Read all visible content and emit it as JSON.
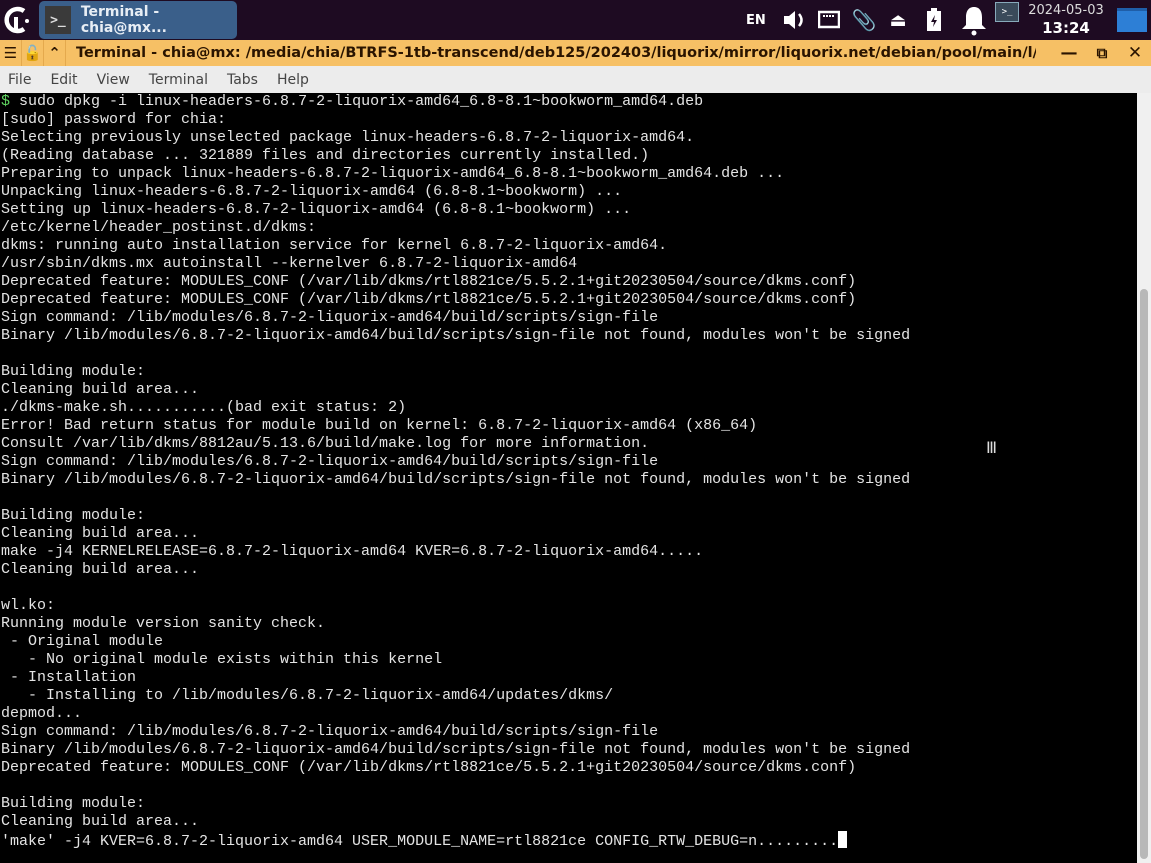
{
  "panel": {
    "task_title": "Terminal - chia@mx...",
    "lang": "EN",
    "date": "2024-05-03",
    "time": "13:24",
    "tray_icons": [
      "volume-icon",
      "network-icon",
      "clipboard-icon",
      "eject-icon",
      "battery-icon",
      "notification-bell-icon",
      "terminal-icon"
    ]
  },
  "window": {
    "title": "Terminal - chia@mx: /media/chia/BTRFS-1tb-transcend/deb125/202403/liquorix/mirror/liquorix.net/debian/pool/main/l/linux-liquorix",
    "accent": "#f6c065"
  },
  "menu": [
    "File",
    "Edit",
    "View",
    "Terminal",
    "Tabs",
    "Help"
  ],
  "terminal": {
    "prompt": "$",
    "command": " sudo dpkg -i linux-headers-6.8.7-2-liquorix-amd64_6.8-8.1~bookworm_amd64.deb",
    "lines": [
      "[sudo] password for chia:",
      "Selecting previously unselected package linux-headers-6.8.7-2-liquorix-amd64.",
      "(Reading database ... 321889 files and directories currently installed.)",
      "Preparing to unpack linux-headers-6.8.7-2-liquorix-amd64_6.8-8.1~bookworm_amd64.deb ...",
      "Unpacking linux-headers-6.8.7-2-liquorix-amd64 (6.8-8.1~bookworm) ...",
      "Setting up linux-headers-6.8.7-2-liquorix-amd64 (6.8-8.1~bookworm) ...",
      "/etc/kernel/header_postinst.d/dkms:",
      "dkms: running auto installation service for kernel 6.8.7-2-liquorix-amd64.",
      "/usr/sbin/dkms.mx autoinstall --kernelver 6.8.7-2-liquorix-amd64",
      "Deprecated feature: MODULES_CONF (/var/lib/dkms/rtl8821ce/5.5.2.1+git20230504/source/dkms.conf)",
      "Deprecated feature: MODULES_CONF (/var/lib/dkms/rtl8821ce/5.5.2.1+git20230504/source/dkms.conf)",
      "Sign command: /lib/modules/6.8.7-2-liquorix-amd64/build/scripts/sign-file",
      "Binary /lib/modules/6.8.7-2-liquorix-amd64/build/scripts/sign-file not found, modules won't be signed",
      "",
      "Building module:",
      "Cleaning build area...",
      "./dkms-make.sh...........(bad exit status: 2)",
      "Error! Bad return status for module build on kernel: 6.8.7-2-liquorix-amd64 (x86_64)",
      "Consult /var/lib/dkms/8812au/5.13.6/build/make.log for more information.",
      "Sign command: /lib/modules/6.8.7-2-liquorix-amd64/build/scripts/sign-file",
      "Binary /lib/modules/6.8.7-2-liquorix-amd64/build/scripts/sign-file not found, modules won't be signed",
      "",
      "Building module:",
      "Cleaning build area...",
      "make -j4 KERNELRELEASE=6.8.7-2-liquorix-amd64 KVER=6.8.7-2-liquorix-amd64.....",
      "Cleaning build area...",
      "",
      "wl.ko:",
      "Running module version sanity check.",
      " - Original module",
      "   - No original module exists within this kernel",
      " - Installation",
      "   - Installing to /lib/modules/6.8.7-2-liquorix-amd64/updates/dkms/",
      "depmod...",
      "Sign command: /lib/modules/6.8.7-2-liquorix-amd64/build/scripts/sign-file",
      "Binary /lib/modules/6.8.7-2-liquorix-amd64/build/scripts/sign-file not found, modules won't be signed",
      "Deprecated feature: MODULES_CONF (/var/lib/dkms/rtl8821ce/5.5.2.1+git20230504/source/dkms.conf)",
      "",
      "Building module:",
      "Cleaning build area...",
      "'make' -j4 KVER=6.8.7-2-liquorix-amd64 USER_MODULE_NAME=rtl8821ce CONFIG_RTW_DEBUG=n........."
    ]
  }
}
